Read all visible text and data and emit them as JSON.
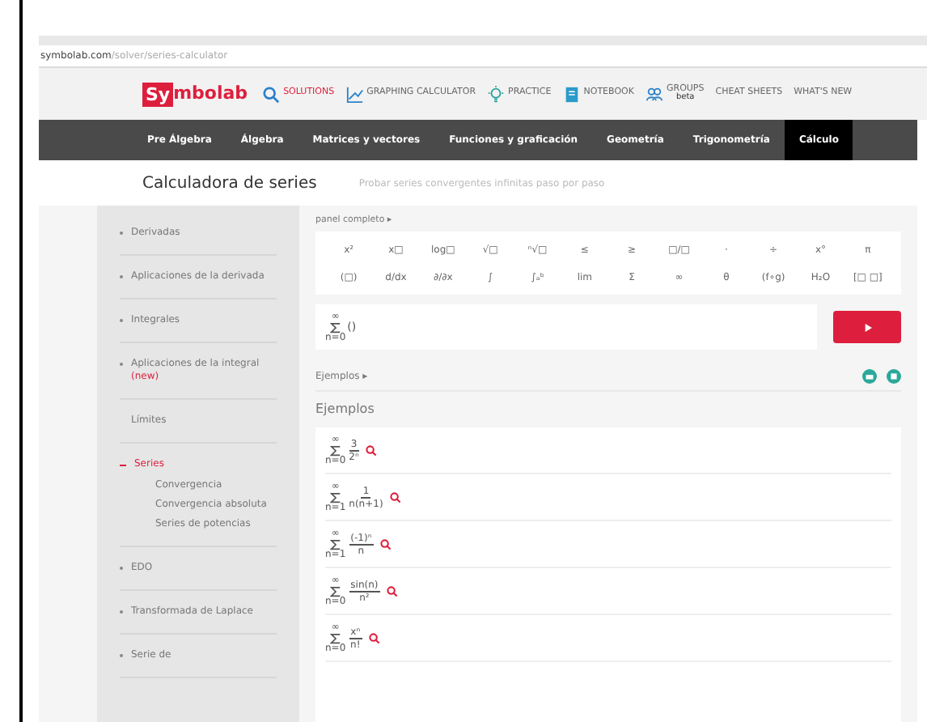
{
  "browser": {
    "url_host": "symbolab.com",
    "url_path": "/solver/series-calculator"
  },
  "header": {
    "logo_mark": "Sy",
    "logo_text": "mbolab",
    "links": [
      {
        "label": "SOLUTIONS",
        "kind": "search",
        "selected": true
      },
      {
        "label": "GRAPHING CALCULATOR",
        "kind": "graph",
        "selected": false
      },
      {
        "label": "PRACTICE",
        "kind": "bulb",
        "selected": false
      },
      {
        "label": "NOTEBOOK",
        "kind": "book",
        "selected": false
      },
      {
        "label": "GROUPS",
        "kind": "groups",
        "badge": "beta",
        "selected": false
      },
      {
        "label": "CHEAT SHEETS",
        "selected": false
      },
      {
        "label": "WHAT'S NEW",
        "selected": false
      }
    ]
  },
  "nav": [
    {
      "label": "Pre Álgebra",
      "selected": false
    },
    {
      "label": "Álgebra",
      "selected": false
    },
    {
      "label": "Matrices y vectores",
      "selected": false
    },
    {
      "label": "Funciones y graficación",
      "selected": false
    },
    {
      "label": "Geometría",
      "selected": false
    },
    {
      "label": "Trigonometría",
      "selected": false
    },
    {
      "label": "Cálculo",
      "selected": true
    }
  ],
  "title": "Calculadora de series",
  "subtitle": "Probar series convergentes infinitas paso por paso",
  "sidebar": [
    {
      "label": "Derivadas",
      "kind": "group",
      "expanded": false,
      "selected": false
    },
    {
      "label": "Aplicaciones de la derivada",
      "kind": "group",
      "expanded": false,
      "selected": false
    },
    {
      "label": "Integrales",
      "kind": "group",
      "expanded": false,
      "selected": false
    },
    {
      "label": "Aplicaciones de la integral",
      "badge": "(new)",
      "kind": "group",
      "expanded": false,
      "selected": false
    },
    {
      "label": "Límites",
      "kind": "link",
      "selected": false
    },
    {
      "label": "Series",
      "kind": "group",
      "expanded": true,
      "selected": true,
      "children": [
        {
          "label": "Convergencia"
        },
        {
          "label": "Convergencia absoluta"
        },
        {
          "label": "Series de potencias"
        }
      ]
    },
    {
      "label": "EDO",
      "kind": "group",
      "expanded": false,
      "selected": false
    },
    {
      "label": "Transformada de Laplace",
      "kind": "group",
      "expanded": false,
      "selected": false
    },
    {
      "label": "Serie de",
      "kind": "group",
      "expanded": false,
      "selected": false
    }
  ],
  "panel_toggle": "panel completo ▸",
  "keys": [
    [
      "x²",
      "x□",
      "log□",
      "√□",
      "ⁿ√□",
      "≤",
      "≥",
      "□/□",
      "·",
      "÷",
      "x°",
      "π"
    ],
    [
      "(□)",
      "d/dx",
      "∂/∂x",
      "∫",
      "∫ₐᵇ",
      "lim",
      "Σ",
      "∞",
      "θ",
      "(f∘g)",
      "H₂O",
      "[□ □]"
    ]
  ],
  "input": {
    "upper": "∞",
    "lower": "n=0",
    "body": "()"
  },
  "examples_toggle": "Ejemplos ▸",
  "examples_title": "Ejemplos",
  "examples": [
    {
      "upper": "∞",
      "lower": "n=0",
      "numerator": "3",
      "denominator": "2ⁿ"
    },
    {
      "upper": "∞",
      "lower": "n=1",
      "numerator": "1",
      "denominator": "n(n+1)"
    },
    {
      "upper": "∞",
      "lower": "n=1",
      "numerator": "(-1)ⁿ",
      "denominator": "n"
    },
    {
      "upper": "∞",
      "lower": "n=0",
      "numerator": "sin(n)",
      "denominator": "n²"
    },
    {
      "upper": "∞",
      "lower": "n=0",
      "numerator": "xⁿ",
      "denominator": "n!"
    }
  ]
}
